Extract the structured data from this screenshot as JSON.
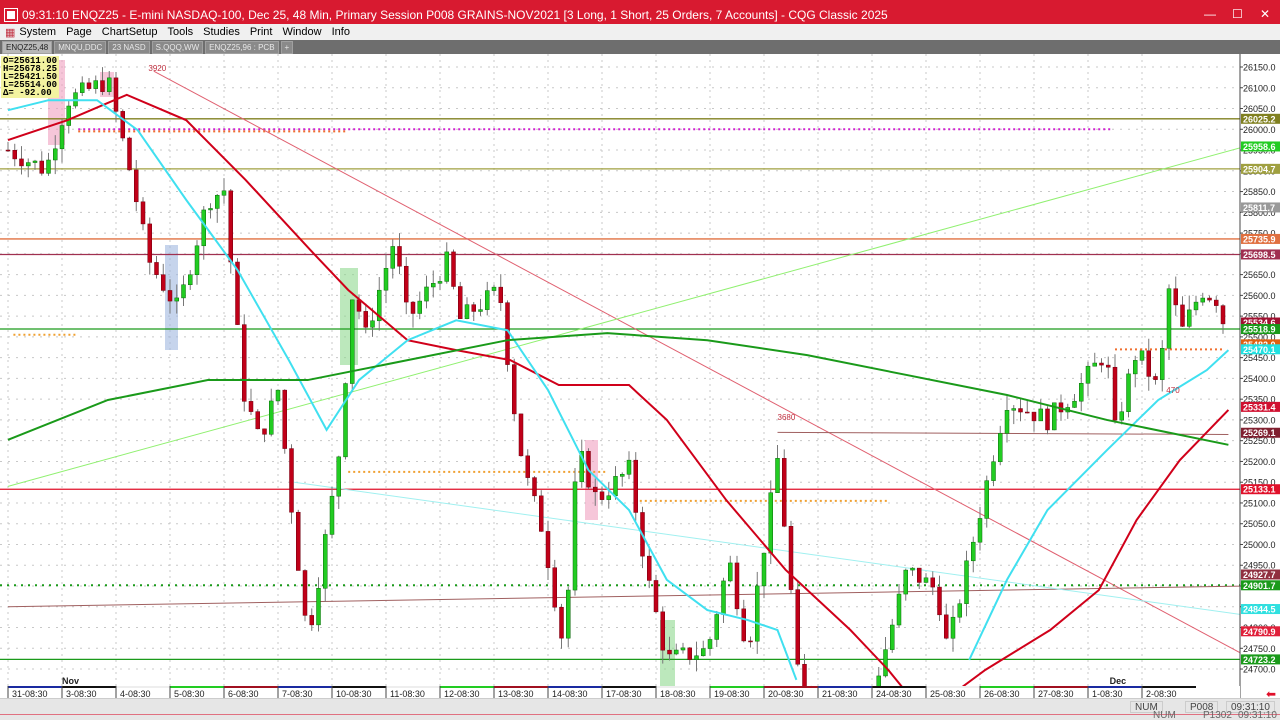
{
  "window": {
    "title": "09:31:10   ENQZ25 - E-mini NASDAQ-100, Dec 25, 48 Min, Primary Session   P008 GRAINS-NOV2021   [3 Long, 1 Short, 25 Orders, 7 Accounts] - CQG Classic 2025",
    "minimize": "—",
    "maximize": "☐",
    "close": "✕"
  },
  "menu": [
    "System",
    "Page",
    "ChartSetup",
    "Tools",
    "Studies",
    "Print",
    "Window",
    "Info"
  ],
  "tabs": [
    "ENQZ25,48",
    "MNQU,DDC",
    "23 NASD",
    "S.QQQ,WW",
    "ENQZ25,96 : PCB",
    "+"
  ],
  "ohlc": [
    "O=25611.00",
    "H=25678.25",
    "L=25421.50",
    "L=25514.00",
    "Δ=   -92.00"
  ],
  "colors": {
    "title": "#d81a30",
    "up": "#22cc22",
    "down": "#c00018",
    "ma_fast": "#d0001a",
    "ma_mid": "#40e0f0",
    "ma_slow": "#1a9a1a"
  },
  "chart_data": {
    "type": "candlestick",
    "symbol": "ENQZ25",
    "interval": "48 Min",
    "ylim": [
      24650,
      26180
    ],
    "y_ticks": [
      26150,
      26100,
      26050,
      26000,
      25950,
      25900,
      25850,
      25800,
      25750,
      25700,
      25650,
      25600,
      25550,
      25500,
      25450,
      25400,
      25350,
      25300,
      25250,
      25200,
      25150,
      25100,
      25050,
      25000,
      24950,
      24900,
      24850,
      24800,
      24750,
      24700
    ],
    "x_labels": [
      "31-08:30",
      "3-08:30",
      "4-08:30",
      "5-08:30",
      "6-08:30",
      "7-08:30",
      "10-08:30",
      "11-08:30",
      "12-08:30",
      "13-08:30",
      "14-08:30",
      "17-08:30",
      "18-08:30",
      "19-08:30",
      "20-08:30",
      "21-08:30",
      "24-08:30",
      "25-08:30",
      "26-08:30",
      "27-08:30",
      "1-08:30",
      "2-08:30"
    ],
    "month_labels": [
      {
        "day": 1,
        "label": "Nov"
      },
      {
        "day": 20.4,
        "label": "Dec"
      }
    ],
    "price_path": [
      [
        0,
        25950
      ],
      [
        0.7,
        25902
      ],
      [
        1.1,
        26070
      ],
      [
        1.85,
        26118
      ],
      [
        2.3,
        25878
      ],
      [
        2.6,
        25685
      ],
      [
        3.15,
        25565
      ],
      [
        3.7,
        25830
      ],
      [
        4.0,
        25854
      ],
      [
        4.35,
        25372
      ],
      [
        4.65,
        25252
      ],
      [
        5.0,
        25372
      ],
      [
        5.3,
        25035
      ],
      [
        5.55,
        24770
      ],
      [
        6.1,
        25180
      ],
      [
        6.4,
        25637
      ],
      [
        6.6,
        25492
      ],
      [
        7.15,
        25733
      ],
      [
        7.4,
        25540
      ],
      [
        8.15,
        25685
      ],
      [
        8.35,
        25540
      ],
      [
        9.1,
        25613
      ],
      [
        9.35,
        25348
      ],
      [
        9.55,
        25180
      ],
      [
        9.9,
        25035
      ],
      [
        10.3,
        24746
      ],
      [
        10.55,
        25228
      ],
      [
        10.9,
        25107
      ],
      [
        11.5,
        25180
      ],
      [
        11.85,
        24915
      ],
      [
        12.2,
        24722
      ],
      [
        12.95,
        24746
      ],
      [
        13.35,
        24963
      ],
      [
        13.7,
        24746
      ],
      [
        14.25,
        25204
      ],
      [
        14.45,
        24963
      ],
      [
        14.65,
        24650
      ],
      [
        15.9,
        24600
      ],
      [
        16.3,
        24770
      ],
      [
        16.65,
        24939
      ],
      [
        17.2,
        24891
      ],
      [
        17.4,
        24746
      ],
      [
        18.05,
        25107
      ],
      [
        18.35,
        25276
      ],
      [
        18.5,
        25348
      ],
      [
        19.25,
        25300
      ],
      [
        19.8,
        25372
      ],
      [
        20.35,
        25468
      ],
      [
        20.45,
        25252
      ],
      [
        20.9,
        25468
      ],
      [
        21.3,
        25372
      ],
      [
        21.5,
        25613
      ],
      [
        21.75,
        25516
      ],
      [
        22.1,
        25613
      ],
      [
        22.4,
        25590
      ],
      [
        22.55,
        25514
      ]
    ],
    "studies": [
      {
        "name": "MA fast",
        "color": "#d0001a",
        "segments": [
          [
            [
              0,
              25974
            ],
            [
              1.1,
              26022
            ],
            [
              2.2,
              26083
            ],
            [
              3.3,
              26022
            ],
            [
              4.4,
              25878
            ],
            [
              5.6,
              25709
            ],
            [
              6.3,
              25613
            ],
            [
              7.4,
              25492
            ],
            [
              8.3,
              25468
            ],
            [
              9.3,
              25444
            ],
            [
              10.2,
              25384
            ],
            [
              11.5,
              25384
            ],
            [
              12.2,
              25300
            ],
            [
              13.3,
              25107
            ],
            [
              14.4,
              24939
            ],
            [
              15.6,
              24794
            ],
            [
              16.3,
              24698
            ],
            [
              16.6,
              24650
            ]
          ],
          [
            [
              17.6,
              24650
            ],
            [
              18.1,
              24698
            ],
            [
              19.3,
              24794
            ],
            [
              20.2,
              24890
            ],
            [
              20.9,
              25059
            ],
            [
              21.7,
              25203
            ],
            [
              22.6,
              25324
            ]
          ]
        ]
      },
      {
        "name": "MA mid",
        "color": "#40e0f0",
        "segments": [
          [
            [
              0,
              26046
            ],
            [
              0.75,
              26070
            ],
            [
              1.65,
              26070
            ],
            [
              2.4,
              25998
            ],
            [
              3.3,
              25830
            ],
            [
              4.25,
              25661
            ],
            [
              5.2,
              25444
            ],
            [
              5.9,
              25276
            ],
            [
              6.5,
              25396
            ],
            [
              7.4,
              25492
            ],
            [
              8.3,
              25540
            ],
            [
              9.25,
              25516
            ],
            [
              10.0,
              25372
            ],
            [
              10.75,
              25179
            ],
            [
              11.5,
              25083
            ],
            [
              12.2,
              24915
            ],
            [
              12.95,
              24842
            ],
            [
              13.7,
              24818
            ],
            [
              14.25,
              24794
            ],
            [
              14.6,
              24674
            ]
          ],
          [
            [
              17.8,
              24722
            ],
            [
              18.5,
              24915
            ],
            [
              19.25,
              25083
            ],
            [
              20.35,
              25227
            ],
            [
              21.3,
              25348
            ],
            [
              22.2,
              25420
            ],
            [
              22.6,
              25468
            ]
          ]
        ]
      },
      {
        "name": "MA slow",
        "color": "#1a9a1a",
        "segments": [
          [
            [
              0,
              25252
            ],
            [
              1.85,
              25348
            ],
            [
              3.7,
              25396
            ],
            [
              5.55,
              25396
            ],
            [
              7.4,
              25444
            ],
            [
              9.25,
              25492
            ],
            [
              11.1,
              25509
            ],
            [
              12.95,
              25492
            ],
            [
              14.8,
              25456
            ],
            [
              16.65,
              25408
            ],
            [
              18.5,
              25360
            ],
            [
              20.35,
              25300
            ],
            [
              22.6,
              25240
            ]
          ]
        ]
      }
    ],
    "horizontal_levels": [
      {
        "price": 26025.25,
        "label": "26025.2",
        "color": "#808020",
        "style": "solid"
      },
      {
        "price": 25958.6,
        "label": "25958.6",
        "color": "#22cc22",
        "style": "none"
      },
      {
        "price": 25904.7,
        "label": "25904.7",
        "color": "#a0a040",
        "style": "solid"
      },
      {
        "price": 25811.7,
        "label": "25811.7",
        "color": "#999999",
        "style": "none"
      },
      {
        "price": 25735.9,
        "label": "25735.9",
        "color": "#e07040",
        "style": "solid"
      },
      {
        "price": 25698.5,
        "label": "25698.5",
        "color": "#a03050",
        "style": "solid"
      },
      {
        "price": 25534.6,
        "label": "25534.6",
        "color": "#a01030",
        "style": "none"
      },
      {
        "price": 25518.9,
        "label": "25518.9",
        "color": "#1a9a1a",
        "style": "solid"
      },
      {
        "price": 25482.0,
        "label": "25482.0",
        "color": "#e06010",
        "style": "none"
      },
      {
        "price": 25470.1,
        "label": "25470.1",
        "color": "#20e0e0",
        "style": "none"
      },
      {
        "price": 25331.4,
        "label": "25331.4",
        "color": "#d01030",
        "style": "none"
      },
      {
        "price": 25269.1,
        "label": "25269.1",
        "color": "#802030",
        "style": "none"
      },
      {
        "price": 25133.1,
        "label": "25133.1",
        "color": "#e0102a",
        "style": "solid"
      },
      {
        "price": 24927.7,
        "label": "24927.7",
        "color": "#903040",
        "style": "none"
      },
      {
        "price": 24901.7,
        "label": "24901.7",
        "color": "#1a9a1a",
        "style": "dotted"
      },
      {
        "price": 24844.5,
        "label": "24844.5",
        "color": "#30e0e0",
        "style": "none"
      },
      {
        "price": 24790.9,
        "label": "24790.9",
        "color": "#e0203a",
        "style": "none"
      },
      {
        "price": 24723.2,
        "label": "24723.2",
        "color": "#1a9a1a",
        "style": "solid"
      }
    ],
    "trendlines": [
      {
        "from": [
          2.7,
          26140
        ],
        "to": [
          22.95,
          24730
        ],
        "color": "#e06070"
      },
      {
        "from": [
          0,
          25140
        ],
        "to": [
          22.95,
          25960
        ],
        "color": "#90f070"
      },
      {
        "from": [
          0,
          24850
        ],
        "to": [
          22.95,
          24900
        ],
        "color": "#a06060"
      },
      {
        "from": [
          14.25,
          25270
        ],
        "to": [
          22.6,
          25265
        ],
        "color": "#a06060"
      },
      {
        "from": [
          5.3,
          25150
        ],
        "to": [
          22.9,
          24830
        ],
        "color": "#a0f0f0"
      }
    ],
    "order_levels": [
      {
        "price": 26000,
        "from": 1.3,
        "to": 20.45,
        "color": "#d020d0"
      },
      {
        "price": 25995,
        "from": 1.3,
        "to": 6.3,
        "color": "#f07030"
      },
      {
        "price": 25505,
        "from": 0.1,
        "to": 1.3,
        "color": "#f0a030"
      },
      {
        "price": 25175,
        "from": 6.3,
        "to": 11.1,
        "color": "#f0a030"
      },
      {
        "price": 25105,
        "from": 11.7,
        "to": 16.3,
        "color": "#f0a030"
      },
      {
        "price": 25470,
        "from": 20.5,
        "to": 22.5,
        "color": "#f07030"
      }
    ],
    "annotations": [
      {
        "day": 2.6,
        "price": 26140,
        "text": "3920"
      },
      {
        "day": 14.25,
        "price": 25300,
        "text": "3680"
      },
      {
        "day": 21.45,
        "price": 25365,
        "text": "470"
      }
    ]
  },
  "status": {
    "num": "NUM",
    "account": "P008",
    "time": "09:31:10",
    "ghost_account": "P1302",
    "ghost_time": "09:31:10"
  }
}
